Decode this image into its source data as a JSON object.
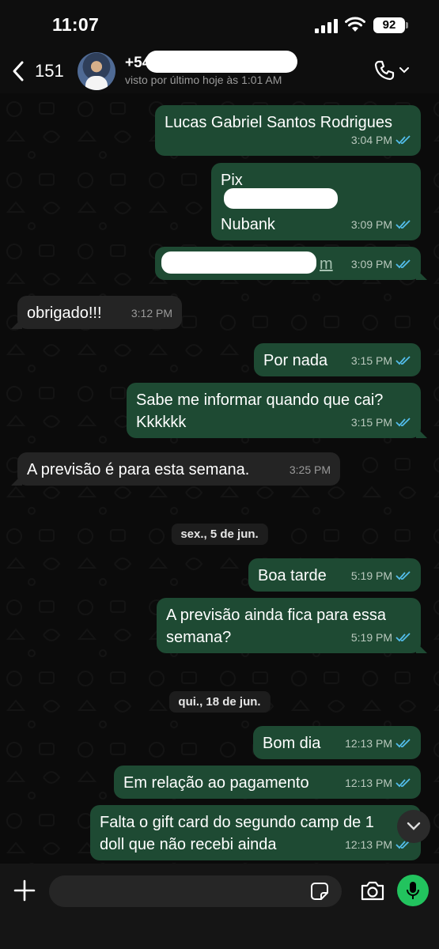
{
  "status_bar": {
    "time": "11:07",
    "battery": "92"
  },
  "header": {
    "back_count": "151",
    "contact_name": "+54",
    "last_seen": "visto por último hoje às 1:01 AM"
  },
  "colors": {
    "outgoing_bubble": "#1e4a33",
    "incoming_bubble": "#242424",
    "tick_blue": "#53bdeb",
    "mic_green": "#22c35e"
  },
  "messages": [
    {
      "dir": "out",
      "text": "Lucas Gabriel Santos Rodrigues",
      "time": "3:04 PM"
    },
    {
      "dir": "out",
      "text": "Pix",
      "link": "",
      "text2": "Nubank",
      "time": "3:09 PM"
    },
    {
      "dir": "out",
      "link": "m",
      "time": "3:09 PM"
    },
    {
      "dir": "in",
      "text": "obrigado!!!",
      "time": "3:12 PM"
    },
    {
      "dir": "out",
      "text": "Por nada",
      "time": "3:15 PM"
    },
    {
      "dir": "out",
      "text": "Sabe me informar quando que cai?\nKkkkkk",
      "time": "3:15 PM"
    },
    {
      "dir": "in",
      "text": "A previsão é para esta semana.",
      "time": "3:25 PM"
    },
    {
      "dir": "out",
      "text": "Boa tarde",
      "time": "5:19 PM"
    },
    {
      "dir": "out",
      "text": "A previsão ainda fica para essa\nsemana?",
      "time": "5:19 PM"
    },
    {
      "dir": "out",
      "text": "Bom dia",
      "time": "12:13 PM"
    },
    {
      "dir": "out",
      "text": "Em relação ao pagamento",
      "time": "12:13 PM"
    },
    {
      "dir": "out",
      "text": "Falta o gift card do segundo camp de 1\ndoll que não recebi ainda",
      "time": "12:13 PM"
    }
  ],
  "date_separators": [
    "sex., 5 de jun.",
    "qui., 18 de jun."
  ],
  "icons": [
    "back-chevron-icon",
    "phone-icon",
    "chevron-down-icon",
    "double-check-icon",
    "plus-icon",
    "sticker-icon",
    "camera-icon",
    "mic-icon",
    "arrow-down-icon"
  ]
}
